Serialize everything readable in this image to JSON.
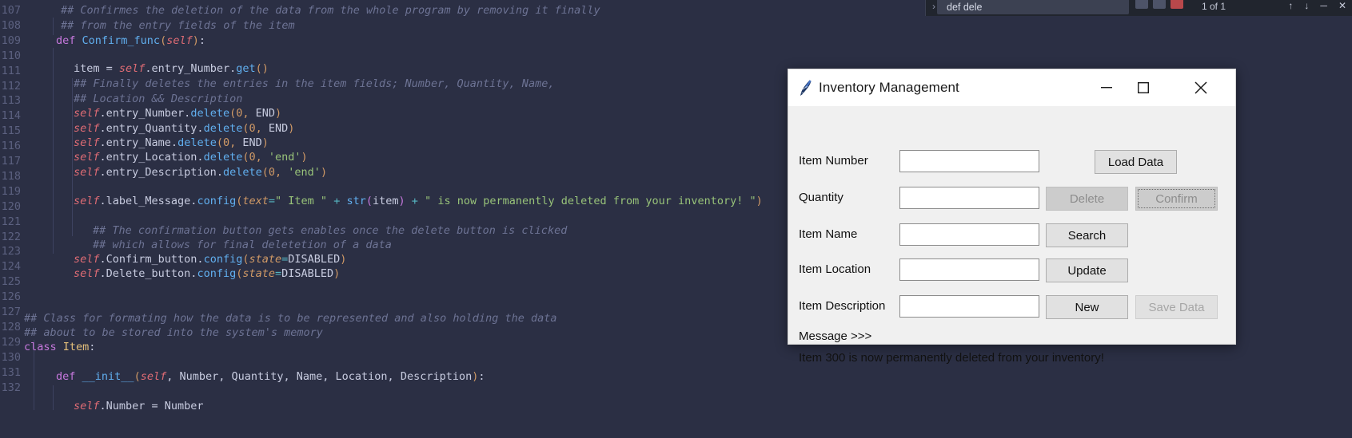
{
  "editor": {
    "language": "python",
    "first_line_number": 107,
    "line_numbers": [
      "107",
      "108",
      "109",
      "110",
      "111",
      "112",
      "113",
      "114",
      "115",
      "116",
      "117",
      "118",
      "119",
      "120",
      "121",
      "122",
      "123",
      "124",
      "125",
      "126",
      "127",
      "128",
      "129",
      "130",
      "131",
      "132"
    ],
    "lines": [
      "    ## Confirmes the deletion of the data from the whole program by removing it finally",
      "    ## from the entry fields of the item",
      "    def Confirm_func(self):",
      "",
      "        item = self.entry_Number.get()",
      "        ## Finally deletes the entries in the item fields; Number, Quantity, Name,",
      "        ## Location && Description",
      "        self.entry_Number.delete(0, END)",
      "        self.entry_Quantity.delete(0, END)",
      "        self.entry_Name.delete(0, END)",
      "        self.entry_Location.delete(0, 'end')",
      "        self.entry_Description.delete(0, 'end')",
      "",
      "        self.label_Message.config(text=\" Item \" + str(item) + \" is now permanently deleted from your inventory! \")",
      "",
      "        ## The confirmation button gets enables once the delete button is clicked",
      "        ## which allows for final deletetion of a data",
      "        self.Confirm_button.config(state=DISABLED)",
      "        self.Delete_button.config(state=DISABLED)",
      "",
      "",
      "## Class for formating how the data is to be represented and also holding the data",
      "## about to be stored into the system's memory",
      "class Item:",
      "",
      "    def __init__(self, Number, Quantity, Name, Location, Description):",
      "",
      "        self.Number = Number"
    ]
  },
  "topbar": {
    "chevron": "›",
    "tab_label": "def dele",
    "page_indicator": "1 of 1",
    "prev_arrow": "↑",
    "next_arrow": "↓",
    "minimize": "─",
    "close": "✕"
  },
  "dialog": {
    "title": "Inventory Management",
    "icon": "python-feather-icon",
    "window_controls": {
      "minimize": "—",
      "maximize": "☐",
      "close": "✕"
    },
    "fields": [
      {
        "label": "Item Number",
        "value": "",
        "name": "item-number"
      },
      {
        "label": "Quantity",
        "value": "",
        "name": "quantity"
      },
      {
        "label": "Item Name",
        "value": "",
        "name": "item-name"
      },
      {
        "label": "Item Location",
        "value": "",
        "name": "item-location"
      },
      {
        "label": "Item Description",
        "value": "",
        "name": "item-description"
      }
    ],
    "buttons": {
      "load_data": {
        "label": "Load Data",
        "state": "enabled"
      },
      "delete": {
        "label": "Delete",
        "state": "disabled"
      },
      "confirm": {
        "label": "Confirm",
        "state": "disabled-focused"
      },
      "search": {
        "label": "Search",
        "state": "enabled"
      },
      "update": {
        "label": "Update",
        "state": "enabled"
      },
      "new": {
        "label": "New",
        "state": "enabled"
      },
      "save_data": {
        "label": "Save Data",
        "state": "disabled"
      }
    },
    "message_title": "Message >>>",
    "message_text": "Item 300 is now permanently deleted from your inventory!"
  },
  "colors": {
    "editor_bg": "#2b2f44",
    "dialog_bg": "#f0f0f0",
    "titlebar_bg": "#ffffff",
    "comment": "#6d7394",
    "keyword": "#c678dd",
    "string": "#98c379",
    "self": "#e06c75",
    "function": "#61afef",
    "number": "#d19a66"
  }
}
